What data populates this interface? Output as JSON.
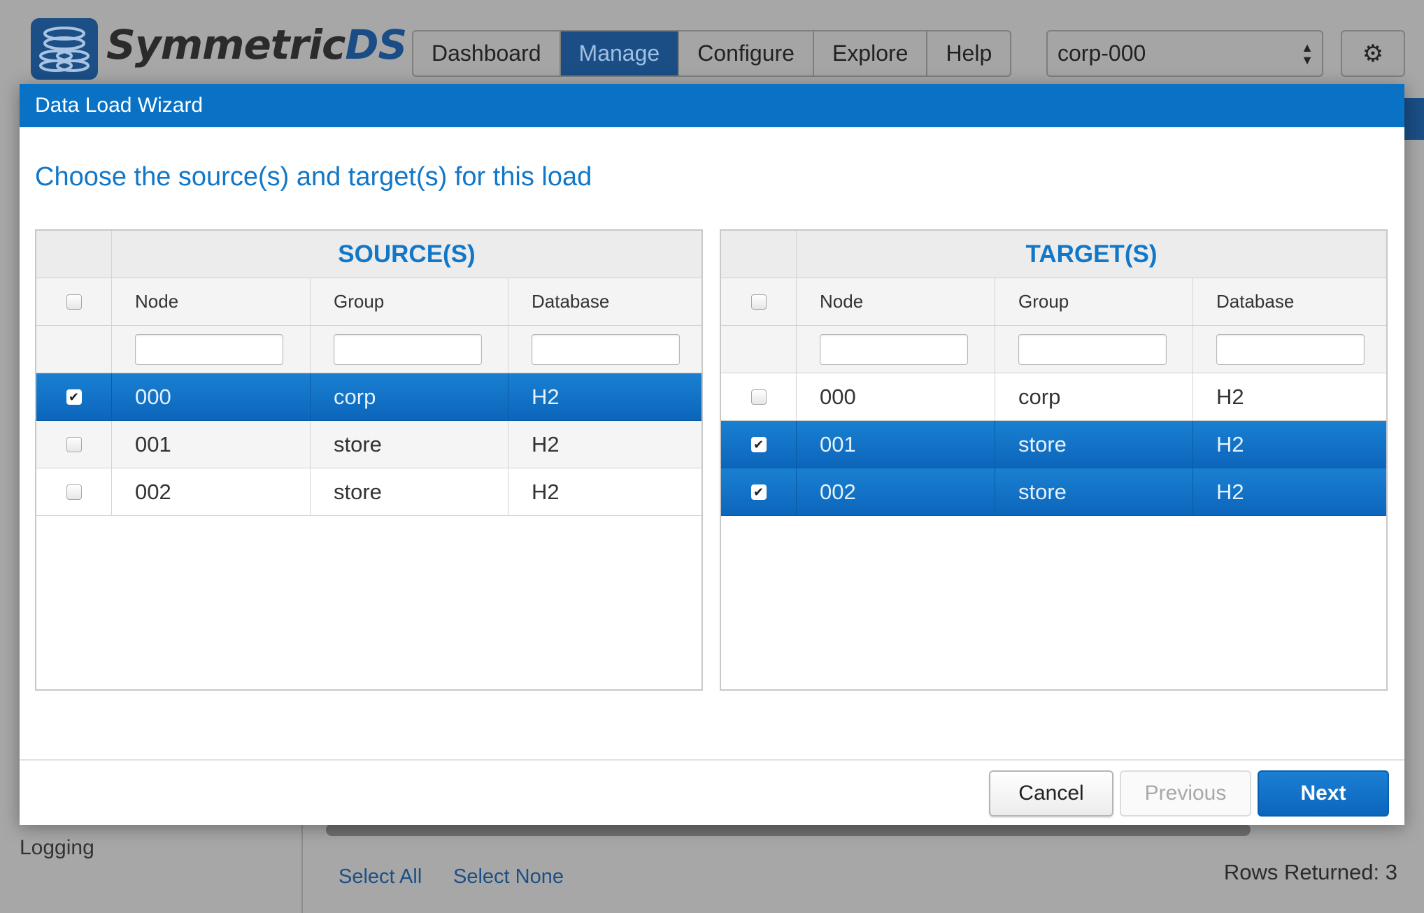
{
  "app": {
    "logo_text_main": "Symmetric",
    "logo_text_accent": "DS",
    "nav": [
      {
        "label": "Dashboard",
        "active": false
      },
      {
        "label": "Manage",
        "active": true
      },
      {
        "label": "Configure",
        "active": false
      },
      {
        "label": "Explore",
        "active": false
      },
      {
        "label": "Help",
        "active": false
      }
    ],
    "node_selector_value": "corp-000",
    "settings_icon": "gears-icon",
    "sidebar_item": "Logging",
    "select_all": "Select All",
    "select_none": "Select None",
    "rows_returned": "Rows Returned: 3"
  },
  "modal": {
    "title": "Data Load Wizard",
    "heading": "Choose the source(s) and target(s) for this load",
    "source": {
      "title": "SOURCE(S)",
      "columns": [
        "Node",
        "Group",
        "Database"
      ],
      "rows": [
        {
          "node": "000",
          "group": "corp",
          "database": "H2",
          "checked": true
        },
        {
          "node": "001",
          "group": "store",
          "database": "H2",
          "checked": false
        },
        {
          "node": "002",
          "group": "store",
          "database": "H2",
          "checked": false
        }
      ]
    },
    "target": {
      "title": "TARGET(S)",
      "columns": [
        "Node",
        "Group",
        "Database"
      ],
      "rows": [
        {
          "node": "000",
          "group": "corp",
          "database": "H2",
          "checked": false
        },
        {
          "node": "001",
          "group": "store",
          "database": "H2",
          "checked": true
        },
        {
          "node": "002",
          "group": "store",
          "database": "H2",
          "checked": true
        }
      ]
    },
    "buttons": {
      "cancel": "Cancel",
      "previous": "Previous",
      "next": "Next"
    }
  },
  "colors": {
    "primary": "#0a72c5",
    "heading": "#1177c8",
    "selected_row": "#0c66bb"
  }
}
